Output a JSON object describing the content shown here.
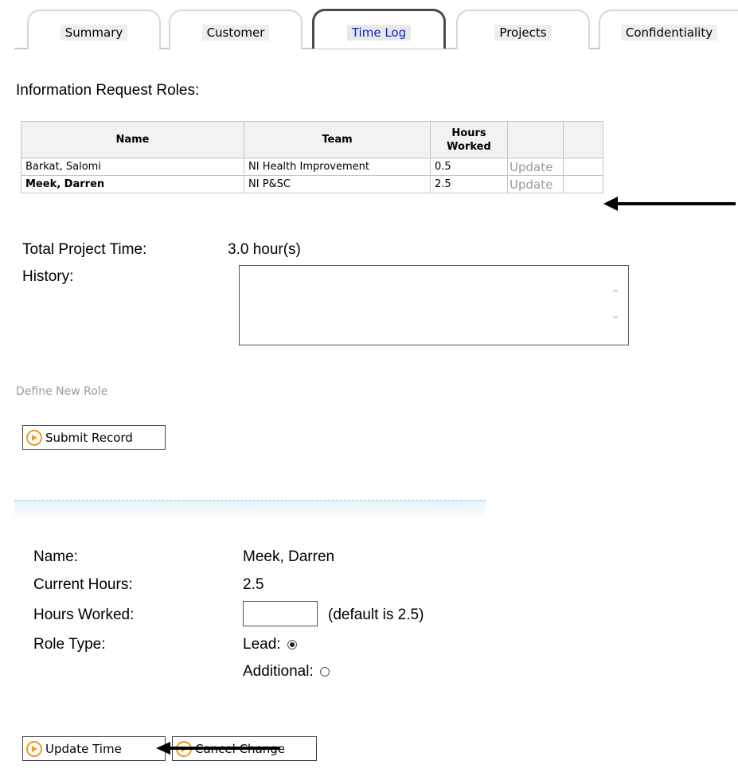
{
  "tabs": [
    {
      "label": "Summary"
    },
    {
      "label": "Customer"
    },
    {
      "label": "Time Log"
    },
    {
      "label": "Projects"
    },
    {
      "label": "Confidentiality"
    }
  ],
  "heading": "Information Request Roles:",
  "table": {
    "headers": {
      "name": "Name",
      "team": "Team",
      "hours": "Hours Worked"
    },
    "rows": [
      {
        "name": "Barkat, Salomi",
        "team": "NI Health Improvement",
        "hours": "0.5",
        "action": "Update"
      },
      {
        "name": "Meek, Darren",
        "team": "NI P&SC",
        "hours": "2.5",
        "action": "Update"
      }
    ]
  },
  "total": {
    "label": "Total Project Time:",
    "value": "3.0 hour(s)"
  },
  "history": {
    "label": "History:",
    "value": ""
  },
  "define_link": "Define New Role",
  "submit_button": "Submit Record",
  "form": {
    "name_label": "Name:",
    "name_value": "Meek, Darren",
    "current_label": "Current Hours:",
    "current_value": "2.5",
    "worked_label": "Hours Worked:",
    "worked_value": "",
    "worked_hint": "(default is 2.5)",
    "role_label": "Role Type:",
    "lead_label": "Lead:",
    "additional_label": "Additional:",
    "selected_role": "Lead"
  },
  "update_button": "Update Time",
  "cancel_button": "Cancel Change",
  "colors": {
    "active_tab_text": "#0b1fd6",
    "button_icon": "#f29a1d",
    "link": "#9a9a9a"
  }
}
